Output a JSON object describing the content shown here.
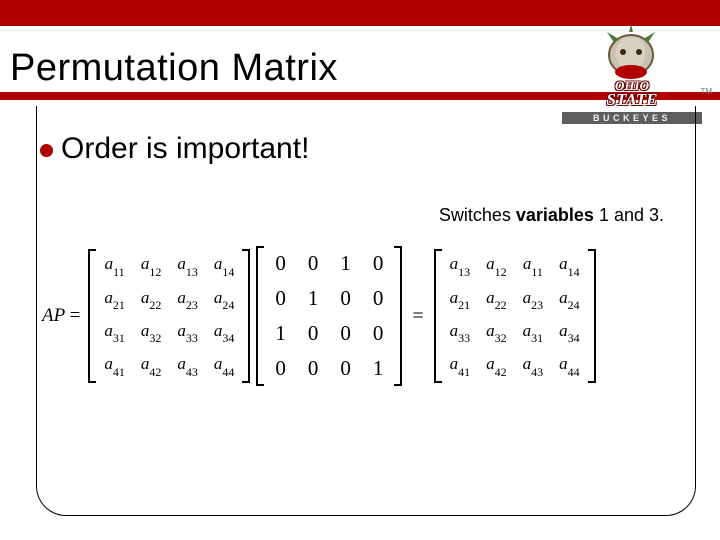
{
  "title": "Permutation Matrix",
  "logo": {
    "line1": "OHIO",
    "line2": "STATE",
    "bar": "BUCKEYES",
    "tm": "TM"
  },
  "bullet": {
    "text": "Order is important!"
  },
  "caption": {
    "pre": "Switches ",
    "bold": "variables",
    "post": " 1 and 3."
  },
  "eq": {
    "lhs": "AP",
    "eq": "=",
    "A": [
      [
        "a",
        "11",
        "a",
        "12",
        "a",
        "13",
        "a",
        "14"
      ],
      [
        "a",
        "21",
        "a",
        "22",
        "a",
        "23",
        "a",
        "24"
      ],
      [
        "a",
        "31",
        "a",
        "32",
        "a",
        "33",
        "a",
        "34"
      ],
      [
        "a",
        "41",
        "a",
        "42",
        "a",
        "43",
        "a",
        "44"
      ]
    ],
    "P": [
      [
        "0",
        "0",
        "1",
        "0"
      ],
      [
        "0",
        "1",
        "0",
        "0"
      ],
      [
        "1",
        "0",
        "0",
        "0"
      ],
      [
        "0",
        "0",
        "0",
        "1"
      ]
    ],
    "R": [
      [
        "a",
        "13",
        "a",
        "12",
        "a",
        "11",
        "a",
        "14"
      ],
      [
        "a",
        "21",
        "a",
        "22",
        "a",
        "23",
        "a",
        "24"
      ],
      [
        "a",
        "33",
        "a",
        "32",
        "a",
        "31",
        "a",
        "34"
      ],
      [
        "a",
        "41",
        "a",
        "42",
        "a",
        "43",
        "a",
        "44"
      ]
    ]
  }
}
